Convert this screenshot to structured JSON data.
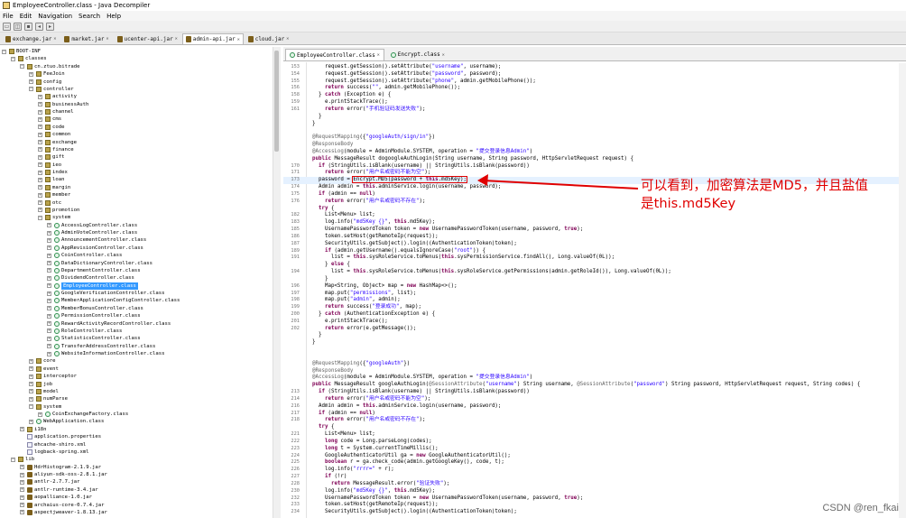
{
  "window": {
    "title": "EmployeeController.class - Java Decompiler"
  },
  "menubar": {
    "items": [
      "File",
      "Edit",
      "Navigation",
      "Search",
      "Help"
    ]
  },
  "jar_tabs": [
    {
      "label": "exchange.jar",
      "active": false
    },
    {
      "label": "market.jar",
      "active": false
    },
    {
      "label": "ucenter-api.jar",
      "active": false
    },
    {
      "label": "admin-api.jar",
      "active": true
    },
    {
      "label": "cloud.jar",
      "active": false
    }
  ],
  "tree": [
    {
      "d": 0,
      "t": "BOOT-INF",
      "i": "pkg",
      "tg": "−"
    },
    {
      "d": 1,
      "t": "classes",
      "i": "pkg",
      "tg": "−"
    },
    {
      "d": 2,
      "t": "cn.ztuo.bitrade",
      "i": "pkg",
      "tg": "−"
    },
    {
      "d": 3,
      "t": "FeeJoin",
      "i": "pkg",
      "tg": "+"
    },
    {
      "d": 3,
      "t": "config",
      "i": "pkg",
      "tg": "+"
    },
    {
      "d": 3,
      "t": "controller",
      "i": "pkg",
      "tg": "−"
    },
    {
      "d": 4,
      "t": "activity",
      "i": "pkg",
      "tg": "+"
    },
    {
      "d": 4,
      "t": "businessAuth",
      "i": "pkg",
      "tg": "+"
    },
    {
      "d": 4,
      "t": "channel",
      "i": "pkg",
      "tg": "+"
    },
    {
      "d": 4,
      "t": "cms",
      "i": "pkg",
      "tg": "+"
    },
    {
      "d": 4,
      "t": "code",
      "i": "pkg",
      "tg": "+"
    },
    {
      "d": 4,
      "t": "common",
      "i": "pkg",
      "tg": "+"
    },
    {
      "d": 4,
      "t": "exchange",
      "i": "pkg",
      "tg": "+"
    },
    {
      "d": 4,
      "t": "finance",
      "i": "pkg",
      "tg": "+"
    },
    {
      "d": 4,
      "t": "gift",
      "i": "pkg",
      "tg": "+"
    },
    {
      "d": 4,
      "t": "ieo",
      "i": "pkg",
      "tg": "+"
    },
    {
      "d": 4,
      "t": "index",
      "i": "pkg",
      "tg": "+"
    },
    {
      "d": 4,
      "t": "loan",
      "i": "pkg",
      "tg": "+"
    },
    {
      "d": 4,
      "t": "margin",
      "i": "pkg",
      "tg": "+"
    },
    {
      "d": 4,
      "t": "member",
      "i": "pkg",
      "tg": "+"
    },
    {
      "d": 4,
      "t": "otc",
      "i": "pkg",
      "tg": "+"
    },
    {
      "d": 4,
      "t": "promotion",
      "i": "pkg",
      "tg": "+"
    },
    {
      "d": 4,
      "t": "system",
      "i": "pkg",
      "tg": "−"
    },
    {
      "d": 5,
      "t": "AccessLogController.class",
      "i": "cls",
      "tg": "+"
    },
    {
      "d": 5,
      "t": "AdminVoteController.class",
      "i": "cls",
      "tg": "+"
    },
    {
      "d": 5,
      "t": "AnnouncementController.class",
      "i": "cls",
      "tg": "+"
    },
    {
      "d": 5,
      "t": "AppRevisionController.class",
      "i": "cls",
      "tg": "+"
    },
    {
      "d": 5,
      "t": "CoinController.class",
      "i": "cls",
      "tg": "+"
    },
    {
      "d": 5,
      "t": "DataDictionaryController.class",
      "i": "cls",
      "tg": "+"
    },
    {
      "d": 5,
      "t": "DepartmentController.class",
      "i": "cls",
      "tg": "+"
    },
    {
      "d": 5,
      "t": "DividendController.class",
      "i": "cls",
      "tg": "+"
    },
    {
      "d": 5,
      "t": "EmployeeController.class",
      "i": "cls",
      "tg": "+",
      "sel": true
    },
    {
      "d": 5,
      "t": "GoogleVerificationController.class",
      "i": "cls",
      "tg": "+"
    },
    {
      "d": 5,
      "t": "MemberApplicationConfigController.class",
      "i": "cls",
      "tg": "+"
    },
    {
      "d": 5,
      "t": "MemberBonusController.class",
      "i": "cls",
      "tg": "+"
    },
    {
      "d": 5,
      "t": "PermissionController.class",
      "i": "cls",
      "tg": "+"
    },
    {
      "d": 5,
      "t": "RewardActivityRecordController.class",
      "i": "cls",
      "tg": "+"
    },
    {
      "d": 5,
      "t": "RoleController.class",
      "i": "cls",
      "tg": "+"
    },
    {
      "d": 5,
      "t": "StatisticsController.class",
      "i": "cls",
      "tg": "+"
    },
    {
      "d": 5,
      "t": "TransferAddressController.class",
      "i": "cls",
      "tg": "+"
    },
    {
      "d": 5,
      "t": "WebsiteInformationController.class",
      "i": "cls",
      "tg": "+"
    },
    {
      "d": 3,
      "t": "core",
      "i": "pkg",
      "tg": "+"
    },
    {
      "d": 3,
      "t": "event",
      "i": "pkg",
      "tg": "+"
    },
    {
      "d": 3,
      "t": "interceptor",
      "i": "pkg",
      "tg": "+"
    },
    {
      "d": 3,
      "t": "job",
      "i": "pkg",
      "tg": "+"
    },
    {
      "d": 3,
      "t": "model",
      "i": "pkg",
      "tg": "+"
    },
    {
      "d": 3,
      "t": "numParse",
      "i": "pkg",
      "tg": "+"
    },
    {
      "d": 3,
      "t": "system",
      "i": "pkg",
      "tg": "−"
    },
    {
      "d": 4,
      "t": "CoinExchangeFactory.class",
      "i": "cls",
      "tg": "+"
    },
    {
      "d": 3,
      "t": "WebApplication.class",
      "i": "cls",
      "tg": "+"
    },
    {
      "d": 2,
      "t": "i18n",
      "i": "pkg",
      "tg": "+"
    },
    {
      "d": 2,
      "t": "application.properties",
      "i": "file",
      "tg": ""
    },
    {
      "d": 2,
      "t": "ehcache-shiro.xml",
      "i": "file",
      "tg": ""
    },
    {
      "d": 2,
      "t": "logback-spring.xml",
      "i": "file",
      "tg": ""
    },
    {
      "d": 1,
      "t": "lib",
      "i": "pkg",
      "tg": "−"
    },
    {
      "d": 2,
      "t": "HdrHistogram-2.1.9.jar",
      "i": "jar",
      "tg": "+"
    },
    {
      "d": 2,
      "t": "aliyun-sdk-oss-2.8.1.jar",
      "i": "jar",
      "tg": "+"
    },
    {
      "d": 2,
      "t": "antlr-2.7.7.jar",
      "i": "jar",
      "tg": "+"
    },
    {
      "d": 2,
      "t": "antlr-runtime-3.4.jar",
      "i": "jar",
      "tg": "+"
    },
    {
      "d": 2,
      "t": "aopalliance-1.0.jar",
      "i": "jar",
      "tg": "+"
    },
    {
      "d": 2,
      "t": "archaius-core-0.7.4.jar",
      "i": "jar",
      "tg": "+"
    },
    {
      "d": 2,
      "t": "aspectjweaver-1.8.13.jar",
      "i": "jar",
      "tg": "+"
    }
  ],
  "code_tabs": [
    {
      "label": "EmployeeController.class",
      "active": true
    },
    {
      "label": "Encrypt.class",
      "active": false
    }
  ],
  "code_lines": [
    {
      "n": "153",
      "s": "    request.getSession().setAttribute(\"username\", username);"
    },
    {
      "n": "154",
      "s": "    request.getSession().setAttribute(\"password\", password);"
    },
    {
      "n": "155",
      "s": "    request.getSession().setAttribute(\"phone\", admin.getMobilePhone());"
    },
    {
      "n": "156",
      "s": "    return success(\"\", admin.getMobilePhone());"
    },
    {
      "n": "158",
      "s": "  } catch (Exception e) {"
    },
    {
      "n": "159",
      "s": "    e.printStackTrace();"
    },
    {
      "n": "161",
      "s": "    return error(\"手机验证码发送失败\");"
    },
    {
      "n": "",
      "s": "  }"
    },
    {
      "n": "",
      "s": "}"
    },
    {
      "n": "",
      "s": ""
    },
    {
      "n": "",
      "s": "@RequestMapping({\"googleAuth/sign/in\"})"
    },
    {
      "n": "",
      "s": "@ResponseBody"
    },
    {
      "n": "",
      "s": "@AccessLog(module = AdminModule.SYSTEM, operation = \"提交登录信息Admin\")"
    },
    {
      "n": "",
      "s": "public MessageResult dogoogleAuthLogin(String username, String password, HttpServletRequest request) {"
    },
    {
      "n": "170",
      "s": "  if (StringUtils.isBlank(username) || StringUtils.isBlank(password))"
    },
    {
      "n": "171",
      "s": "    return error(\"用户名或密码不能为空\");"
    },
    {
      "n": "173",
      "s": "  password = Encrypt.MD5(password + this.md5Key);"
    },
    {
      "n": "174",
      "s": "  Admin admin = this.adminService.login(username, password);"
    },
    {
      "n": "175",
      "s": "  if (admin == null)"
    },
    {
      "n": "176",
      "s": "    return error(\"用户名或密码不存在\");"
    },
    {
      "n": "",
      "s": "  try {"
    },
    {
      "n": "182",
      "s": "    List<Menu> list;"
    },
    {
      "n": "183",
      "s": "    log.info(\"md5Key {}\", this.md5Key);"
    },
    {
      "n": "185",
      "s": "    UsernamePasswordToken token = new UsernamePasswordToken(username, password, true);"
    },
    {
      "n": "186",
      "s": "    token.setHost(getRemoteIp(request));"
    },
    {
      "n": "187",
      "s": "    SecurityUtils.getSubject().login((AuthenticationToken)token);"
    },
    {
      "n": "189",
      "s": "    if (admin.getUsername().equalsIgnoreCase(\"root\")) {"
    },
    {
      "n": "191",
      "s": "      list = this.sysRoleService.toMenus(this.sysPermissionService.findAll(), Long.valueOf(0L));"
    },
    {
      "n": "",
      "s": "    } else {"
    },
    {
      "n": "194",
      "s": "      list = this.sysRoleService.toMenus(this.sysRoleService.getPermissions(admin.getRoleId()), Long.valueOf(0L));"
    },
    {
      "n": "",
      "s": "    }"
    },
    {
      "n": "196",
      "s": "    Map<String, Object> map = new HashMap<>();"
    },
    {
      "n": "197",
      "s": "    map.put(\"permissions\", list);"
    },
    {
      "n": "198",
      "s": "    map.put(\"admin\", admin);"
    },
    {
      "n": "199",
      "s": "    return success(\"登录成功\", map);"
    },
    {
      "n": "200",
      "s": "  } catch (AuthenticationException e) {"
    },
    {
      "n": "201",
      "s": "    e.printStackTrace();"
    },
    {
      "n": "202",
      "s": "    return error(e.getMessage());"
    },
    {
      "n": "",
      "s": "  }"
    },
    {
      "n": "",
      "s": "}"
    },
    {
      "n": "",
      "s": ""
    },
    {
      "n": "",
      "s": ""
    },
    {
      "n": "",
      "s": "@RequestMapping({\"googleAuth\"})"
    },
    {
      "n": "",
      "s": "@ResponseBody"
    },
    {
      "n": "",
      "s": "@AccessLog(module = AdminModule.SYSTEM, operation = \"提交登录信息Admin\")"
    },
    {
      "n": "",
      "s": "public MessageResult googleAuthLogin(@SessionAttribute(\"username\") String username, @SessionAttribute(\"password\") String password, HttpServletRequest request, String codes) {"
    },
    {
      "n": "213",
      "s": "  if (StringUtils.isBlank(username) || StringUtils.isBlank(password))"
    },
    {
      "n": "214",
      "s": "    return error(\"用户名或密码不能为空\");"
    },
    {
      "n": "216",
      "s": "  Admin admin = this.adminService.login(username, password);"
    },
    {
      "n": "217",
      "s": "  if (admin == null)"
    },
    {
      "n": "218",
      "s": "    return error(\"用户名或密码不存在\");"
    },
    {
      "n": "",
      "s": "  try {"
    },
    {
      "n": "221",
      "s": "    List<Menu> list;"
    },
    {
      "n": "222",
      "s": "    long code = Long.parseLong(codes);"
    },
    {
      "n": "223",
      "s": "    long t = System.currentTimeMillis();"
    },
    {
      "n": "224",
      "s": "    GoogleAuthenticatorUtil ga = new GoogleAuthenticatorUtil();"
    },
    {
      "n": "225",
      "s": "    boolean r = ga.check_code(admin.getGoogleKey(), code, t);"
    },
    {
      "n": "226",
      "s": "    log.info(\"rrrr=\" + r);"
    },
    {
      "n": "227",
      "s": "    if (!r)"
    },
    {
      "n": "228",
      "s": "      return MessageResult.error(\"验证失败\");"
    },
    {
      "n": "230",
      "s": "    log.info(\"md5Key {}\", this.md5Key);"
    },
    {
      "n": "232",
      "s": "    UsernamePasswordToken token = new UsernamePasswordToken(username, password, true);"
    },
    {
      "n": "233",
      "s": "    token.setHost(getRemoteIp(request));"
    },
    {
      "n": "234",
      "s": "    SecurityUtils.getSubject().login((AuthenticationToken)token);"
    }
  ],
  "highlight": {
    "line_index": 16,
    "boxed_text": "Encrypt.MD5(password + this.md5Key);"
  },
  "annotation": {
    "text": "可以看到，加密算法是MD5，并且盐值是this.md5Key",
    "color": "#e00000"
  },
  "watermark": {
    "text": "CSDN @ren_fkai"
  }
}
